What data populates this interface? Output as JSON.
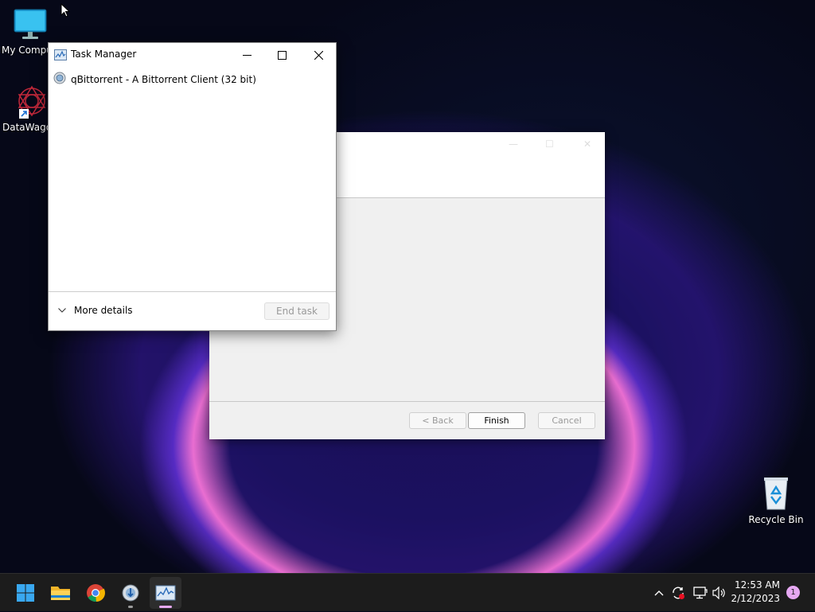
{
  "desktop": {
    "icons": [
      {
        "label": "My Computer",
        "icon": "monitor-icon"
      },
      {
        "label": "DataWagon",
        "icon": "datawagon-icon"
      },
      {
        "label": "Recycle Bin",
        "icon": "recycle-bin-icon"
      }
    ]
  },
  "task_manager": {
    "title": "Task Manager",
    "process": "qBittorrent - A Bittorrent Client (32 bit)",
    "more_details": "More details",
    "end_task": "End task"
  },
  "background_dialog": {
    "back_label": "< Back",
    "finish_label": "Finish",
    "cancel_label": "Cancel"
  },
  "taskbar": {
    "apps": [
      "start-icon",
      "file-explorer-icon",
      "chrome-icon",
      "qbittorrent-setup-icon",
      "task-manager-icon"
    ],
    "time": "12:53 AM",
    "date": "2/12/2023",
    "notification_count": "1"
  },
  "colors": {
    "taskbar": "#1c1c1c",
    "accent_indicator": "#e6a8f2"
  }
}
